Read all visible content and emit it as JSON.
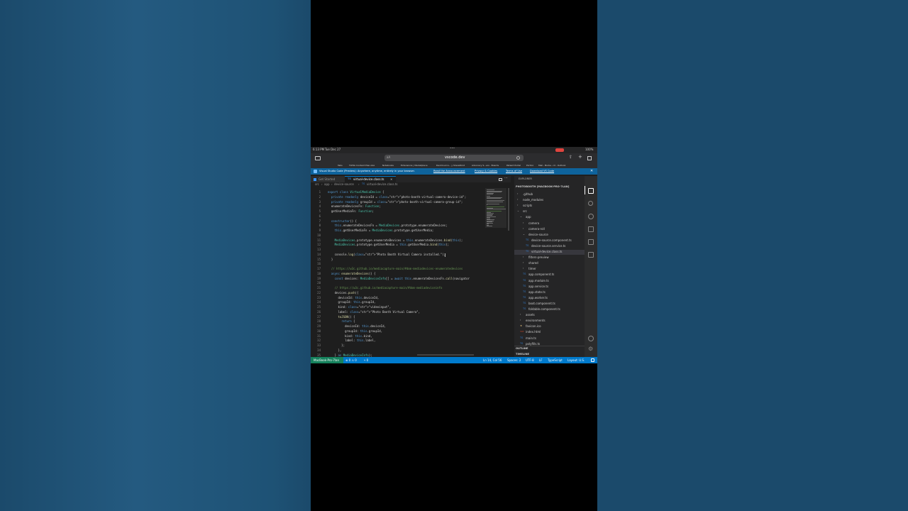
{
  "ios_status": {
    "time": "6:13 PM",
    "date": "Tue Dec 27",
    "battery": "100%"
  },
  "safari": {
    "url": "vscode.dev",
    "reader": "aA",
    "dots": "•••"
  },
  "bookmarks": [
    "Tabs",
    "TikTok Content Plan.xlsx",
    "Notebooks",
    "Extensions | Marketplace",
    "DevCloud A... y SharePoint",
    "Advocacy S...ers · Boards",
    "Patient Portal",
    "Portico",
    "Mail - Burke...rd - Outlook"
  ],
  "banner": {
    "text": "Visual Studio Code (Preview): Anywhere, anytime, entirely in your browser.",
    "links": [
      "Read the Announcement",
      "Privacy & Cookies",
      "Terms of Use",
      "Download VS Code"
    ]
  },
  "tabs": [
    {
      "label": "Get Started"
    },
    {
      "label": "virtual-device.class.ts"
    }
  ],
  "breadcrumb": [
    "src",
    "app",
    "device-source",
    "virtual-device.class.ts"
  ],
  "code_lines": [
    {
      "n": "1",
      "text": "export class VirtualMediaDevice {"
    },
    {
      "n": "2",
      "text": "  private readonly deviceId = \"photo-booth-virtual-camera-device-id\";"
    },
    {
      "n": "3",
      "text": "  private readonly groupId = \"photo-booth-virtual-camera-group-id\";"
    },
    {
      "n": "4",
      "text": "  enumerateDevicesFn: Function;"
    },
    {
      "n": "5",
      "text": "  getUserMediaFn: Function;"
    },
    {
      "n": "6",
      "text": ""
    },
    {
      "n": "7",
      "text": "  constructor() {"
    },
    {
      "n": "8",
      "text": "    this.enumerateDevicesFn = MediaDevices.prototype.enumerateDevices;"
    },
    {
      "n": "9",
      "text": "    this.getUserMediaFn = MediaDevices.prototype.getUserMedia;"
    },
    {
      "n": "10",
      "text": ""
    },
    {
      "n": "11",
      "text": "    MediaDevices.prototype.enumerateDevices = this.enumerateDevices.bind(this);"
    },
    {
      "n": "12",
      "text": "    MediaDevices.prototype.getUserMedia = this.getUserMedia.bind(this);"
    },
    {
      "n": "13",
      "text": ""
    },
    {
      "n": "14",
      "text": "    console.log(\"Photo Booth Virtual Camera installed.\");"
    },
    {
      "n": "15",
      "text": "  }"
    },
    {
      "n": "16",
      "text": ""
    },
    {
      "n": "17",
      "text": "  // https://w3c.github.io/mediacapture-main/#dom-mediadevices-enumeratedevices"
    },
    {
      "n": "18",
      "text": "  async enumerateDevices() {"
    },
    {
      "n": "19",
      "text": "    const devices: MediaDeviceInfo[] = await this.enumerateDevicesFn.call(navigator"
    },
    {
      "n": "20",
      "text": ""
    },
    {
      "n": "21",
      "text": "    // https://w3c.github.io/mediacapture-main/#dom-mediadeviceinfo"
    },
    {
      "n": "22",
      "text": "    devices.push({"
    },
    {
      "n": "23",
      "text": "      deviceId: this.deviceId,"
    },
    {
      "n": "24",
      "text": "      groupId: this.groupId,"
    },
    {
      "n": "25",
      "text": "      kind: \"videoinput\","
    },
    {
      "n": "26",
      "text": "      label: \"Photo Booth Virtual Camera\","
    },
    {
      "n": "27",
      "text": "      toJSON() {"
    },
    {
      "n": "28",
      "text": "        return {"
    },
    {
      "n": "29",
      "text": "          deviceId: this.deviceId,"
    },
    {
      "n": "30",
      "text": "          groupId: this.groupId,"
    },
    {
      "n": "31",
      "text": "          kind: this.kind,"
    },
    {
      "n": "32",
      "text": "          label: this.label,"
    },
    {
      "n": "33",
      "text": "        };"
    },
    {
      "n": "34",
      "text": "      },"
    },
    {
      "n": "35",
      "text": "    } as MediaDeviceInfo);"
    }
  ],
  "explorer": {
    "header": "EXPLORER",
    "root": "PHOTOBOOTH [MACBOOK-PRO-7LAN]",
    "items": [
      {
        "label": ".github",
        "kind": "folder"
      },
      {
        "label": "node_modules",
        "kind": "folder"
      },
      {
        "label": "scripts",
        "kind": "folder"
      },
      {
        "label": "src",
        "kind": "folder-open"
      },
      {
        "label": "app",
        "kind": "folder-open"
      },
      {
        "label": "camera",
        "kind": "folder"
      },
      {
        "label": "camera-roll",
        "kind": "folder"
      },
      {
        "label": "device-source",
        "kind": "folder-open"
      },
      {
        "label": "device-source.component.ts",
        "kind": "ts"
      },
      {
        "label": "device-source.service.ts",
        "kind": "ts"
      },
      {
        "label": "virtual-device.class.ts",
        "kind": "ts"
      },
      {
        "label": "filters-preview",
        "kind": "folder"
      },
      {
        "label": "shared",
        "kind": "folder"
      },
      {
        "label": "timer",
        "kind": "folder"
      },
      {
        "label": "app.component.ts",
        "kind": "ts"
      },
      {
        "label": "app.module.ts",
        "kind": "ts"
      },
      {
        "label": "app.service.ts",
        "kind": "ts"
      },
      {
        "label": "app.state.ts",
        "kind": "ts"
      },
      {
        "label": "app.worker.ts",
        "kind": "ts"
      },
      {
        "label": "boot.component.ts",
        "kind": "ts"
      },
      {
        "label": "foldable.component.ts",
        "kind": "ts"
      },
      {
        "label": "assets",
        "kind": "folder"
      },
      {
        "label": "environments",
        "kind": "folder"
      },
      {
        "label": "favicon.ico",
        "kind": "ico"
      },
      {
        "label": "index.html",
        "kind": "html"
      },
      {
        "label": "main.ts",
        "kind": "ts"
      },
      {
        "label": "polyfills.ts",
        "kind": "ts"
      }
    ],
    "outline": "OUTLINE",
    "timeline": "TIMELINE"
  },
  "status": {
    "remote": "MacBook-Pro-7lan",
    "problems": "⊗ 0 ⚠ 0",
    "ports": "⑂ 0",
    "position": "Ln 14, Col 56",
    "spaces": "Spaces: 2",
    "encoding": "UTF-8",
    "eol": "LF",
    "language": "TypeScript",
    "layout": "Layout: U.S."
  },
  "colors": {
    "accent": "#007acc",
    "banner": "#0e639c",
    "remote": "#16825d",
    "editor_bg": "#1e1e1e"
  }
}
